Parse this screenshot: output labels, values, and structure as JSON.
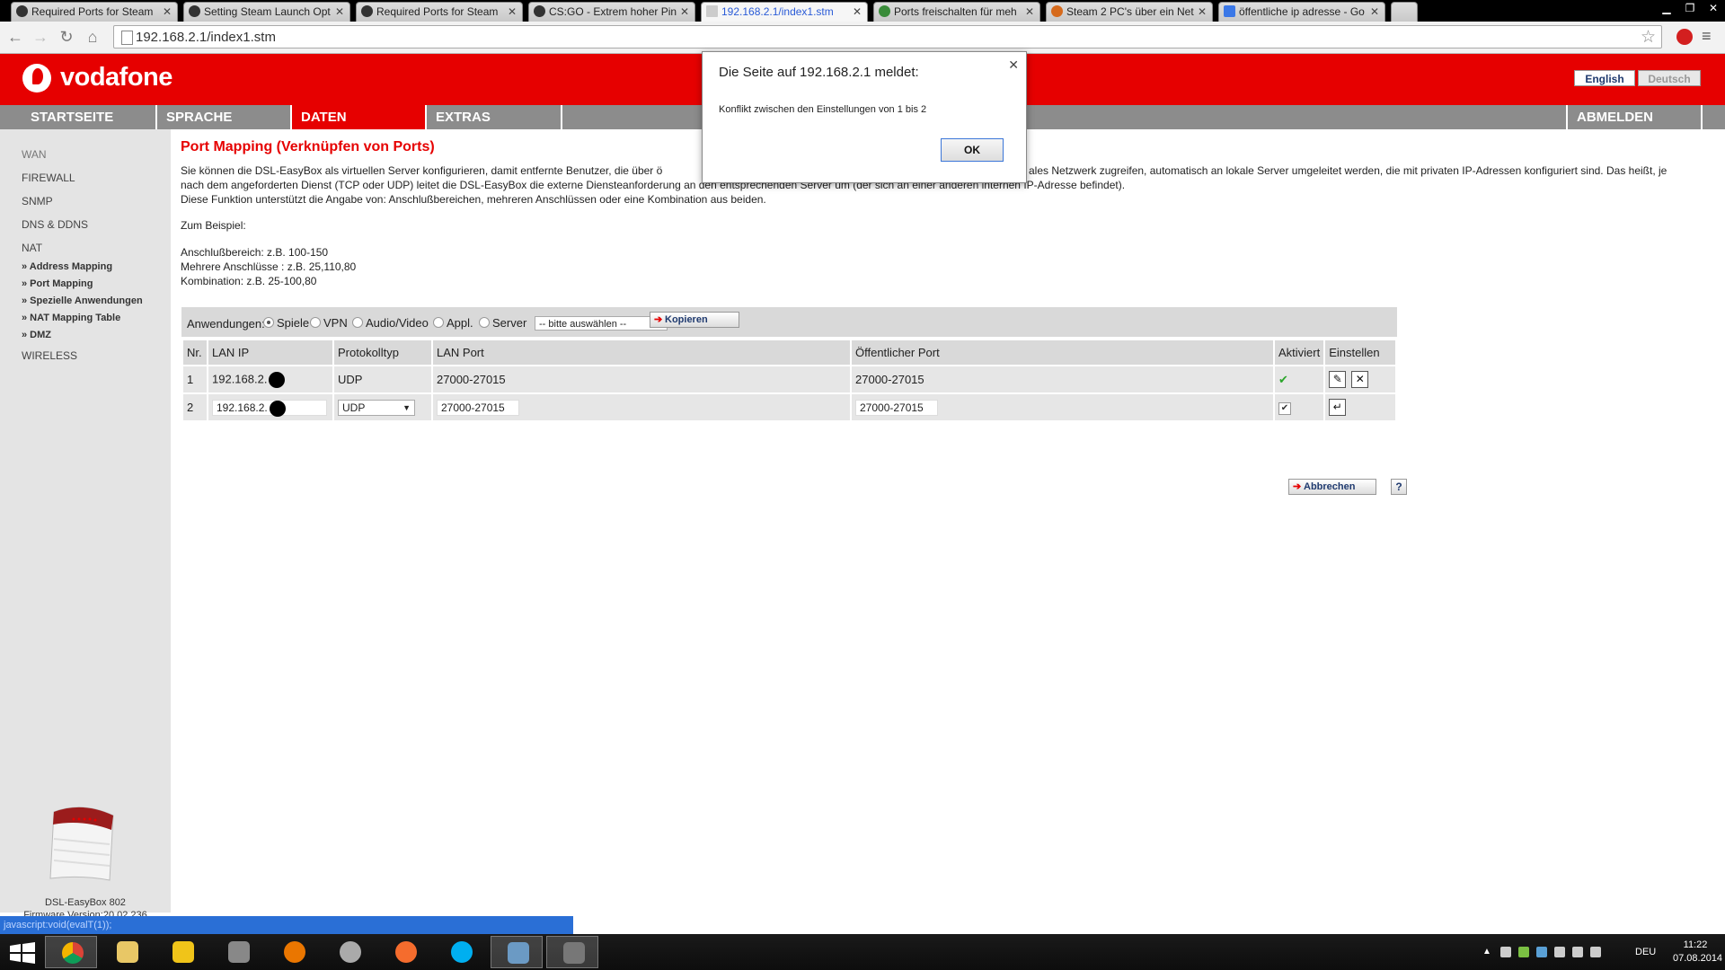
{
  "browser": {
    "tabs": [
      {
        "title": "Required Ports for Steam",
        "active": false
      },
      {
        "title": "Setting Steam Launch Opt",
        "active": false
      },
      {
        "title": "Required Ports for Steam",
        "active": false
      },
      {
        "title": "CS:GO - Extrem hoher Pin",
        "active": false
      },
      {
        "title": "192.168.2.1/index1.stm",
        "active": true
      },
      {
        "title": "Ports freischalten für meh",
        "active": false
      },
      {
        "title": "Steam 2 PC's über ein Net",
        "active": false
      },
      {
        "title": "öffentliche ip adresse - Go",
        "active": false
      }
    ],
    "url": "192.168.2.1/index1.stm",
    "status_text": "javascript:void(evalT(1));"
  },
  "header": {
    "brand": "vodafone",
    "lang_en": "English",
    "lang_de": "Deutsch",
    "brand_color": "#e60000"
  },
  "nav": {
    "items": [
      "STARTSEITE",
      "SPRACHE",
      "DATEN",
      "EXTRAS"
    ],
    "active": "DATEN",
    "logout": "ABMELDEN"
  },
  "sidebar": {
    "items": [
      "WAN",
      "FIREWALL",
      "SNMP",
      "DNS & DDNS",
      "NAT"
    ],
    "subitems": [
      "» Address Mapping",
      "» Port Mapping",
      "» Spezielle Anwendungen",
      "» NAT Mapping Table",
      "» DMZ"
    ],
    "last": "WIRELESS",
    "device_name": "DSL-EasyBox 802",
    "firmware": "Firmware Version:20.02.236"
  },
  "content": {
    "title": "Port Mapping (Verknüpfen von Ports)",
    "paragraph_1a": "Sie können die DSL-EasyBox als virtuellen Server konfigurieren, damit entfernte Benutzer, die über ö",
    "paragraph_1b": "ales Netzwerk zugreifen, automatisch an lokale Server umgeleitet werden, die mit privaten IP-Adressen konfiguriert sind. Das heißt, je",
    "paragraph_2": "nach dem angeforderten Dienst (TCP oder UDP) leitet die DSL-EasyBox die externe Diensteanforderung an den entsprechenden Server um (der sich an einer anderen internen IP-Adresse befindet).",
    "paragraph_3": "Diese Funktion unterstützt die Angabe von: Anschlußbereichen, mehreren Anschlüssen oder eine Kombination aus beiden.",
    "example_heading": "Zum Beispiel:",
    "example_1": "Anschlußbereich: z.B. 100-150",
    "example_2": "Mehrere Anschlüsse : z.B. 25,110,80",
    "example_3": "Kombination: z.B. 25-100,80"
  },
  "applications": {
    "label": "Anwendungen:",
    "options": [
      "Spiele",
      "VPN",
      "Audio/Video",
      "Appl.",
      "Server"
    ],
    "selected": "Spiele",
    "select_value": "-- bitte auswählen --",
    "copy_button": "Kopieren"
  },
  "table": {
    "headers": [
      "Nr.",
      "LAN IP",
      "Protokolltyp",
      "LAN Port",
      "Öffentlicher Port",
      "Aktiviert",
      "Einstellen"
    ],
    "rows": [
      {
        "nr": "1",
        "lan_ip": "192.168.2.",
        "protocol": "UDP",
        "lan_port": "27000-27015",
        "public_port": "27000-27015",
        "enabled": true
      },
      {
        "nr": "2",
        "lan_ip": "192.168.2.",
        "protocol": "UDP",
        "lan_port": "27000-27015",
        "public_port": "27000-27015",
        "enabled": true
      }
    ]
  },
  "actions": {
    "cancel": "Abbrechen",
    "help": "?"
  },
  "dialog": {
    "title": "Die Seite auf 192.168.2.1 meldet:",
    "message": "Konflikt zwischen den Einstellungen von 1 bis 2",
    "ok": "OK"
  },
  "taskbar": {
    "language": "DEU",
    "time": "11:22",
    "date": "07.08.2014"
  }
}
